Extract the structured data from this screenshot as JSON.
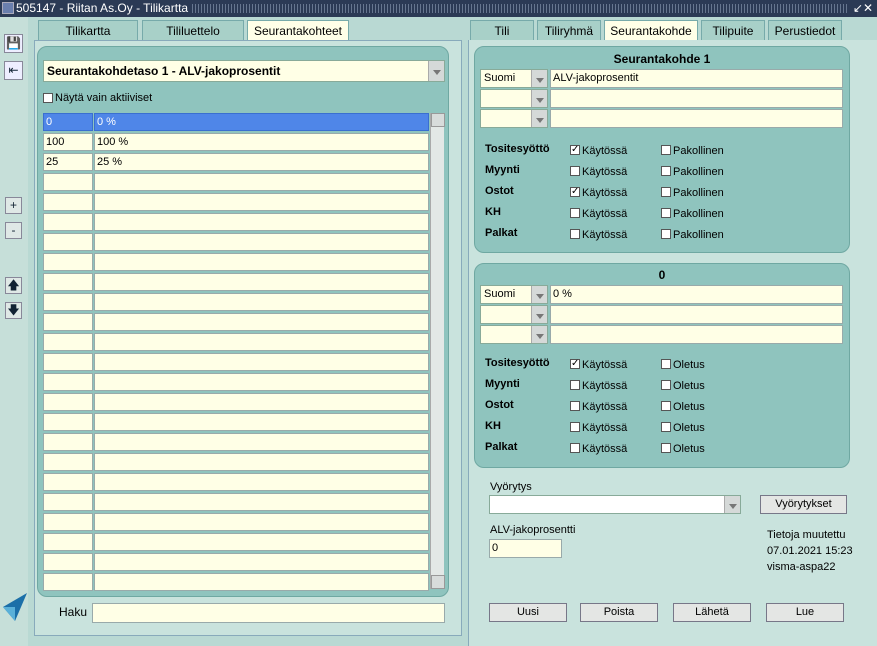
{
  "window": {
    "title": "505147 - Riitan As.Oy - Tilikartta",
    "controls": "↙✕"
  },
  "left_tabs": [
    "Tilikartta",
    "Tililuettelo",
    "Seurantakohteet"
  ],
  "right_tabs": [
    "Tili",
    "Tiliryhmä",
    "Seurantakohde",
    "Tilipuite",
    "Perustiedot"
  ],
  "left_panel": {
    "level_select": "Seurantakohdetaso 1 - ALV-jakoprosentit",
    "only_active_label": "Näytä vain aktiiviset",
    "rows": [
      {
        "code": "0",
        "name": "0 %"
      },
      {
        "code": "100",
        "name": "100 %"
      },
      {
        "code": "25",
        "name": "25 %"
      }
    ],
    "search_label": "Haku",
    "search_value": ""
  },
  "target_panel": {
    "title": "Seurantakohde 1",
    "languages": [
      "Suomi",
      "",
      ""
    ],
    "names": [
      "ALV-jakoprosentit",
      "",
      ""
    ],
    "rows": [
      {
        "label": "Tositesyöttö",
        "enabled": true,
        "required": false
      },
      {
        "label": "Myynti",
        "enabled": false,
        "required": false
      },
      {
        "label": "Ostot",
        "enabled": true,
        "required": false
      },
      {
        "label": "KH",
        "enabled": false,
        "required": false
      },
      {
        "label": "Palkat",
        "enabled": false,
        "required": false
      }
    ],
    "enabled_label": "Käytössä",
    "required_label": "Pakollinen"
  },
  "item_panel": {
    "title": "0",
    "languages": [
      "Suomi",
      "",
      ""
    ],
    "names": [
      "0 %",
      "",
      ""
    ],
    "rows": [
      {
        "label": "Tositesyöttö",
        "enabled": true,
        "default": false
      },
      {
        "label": "Myynti",
        "enabled": false,
        "default": false
      },
      {
        "label": "Ostot",
        "enabled": false,
        "default": false
      },
      {
        "label": "KH",
        "enabled": false,
        "default": false
      },
      {
        "label": "Palkat",
        "enabled": false,
        "default": false
      }
    ],
    "enabled_label": "Käytössä",
    "default_label": "Oletus"
  },
  "bottom": {
    "vyorytys_label": "Vyörytys",
    "vyorytys_value": "",
    "vyorytykset_button": "Vyörytykset",
    "alv_label": "ALV-jakoprosentti",
    "alv_value": "0",
    "modified_label": "Tietoja muutettu",
    "modified_date": "07.01.2021 15:23",
    "modified_user": "visma-aspa22"
  },
  "actions": [
    "Uusi",
    "Poista",
    "Lähetä",
    "Lue"
  ],
  "toolbar_icons": [
    "save-icon",
    "exit-icon",
    "plus-icon",
    "minus-icon",
    "arrow-up-icon",
    "arrow-down-icon"
  ],
  "colors": {
    "panel": "#8fc4be",
    "field": "#ffffe6",
    "selection": "#4f86e8",
    "titlebar": "#2b3a55"
  }
}
